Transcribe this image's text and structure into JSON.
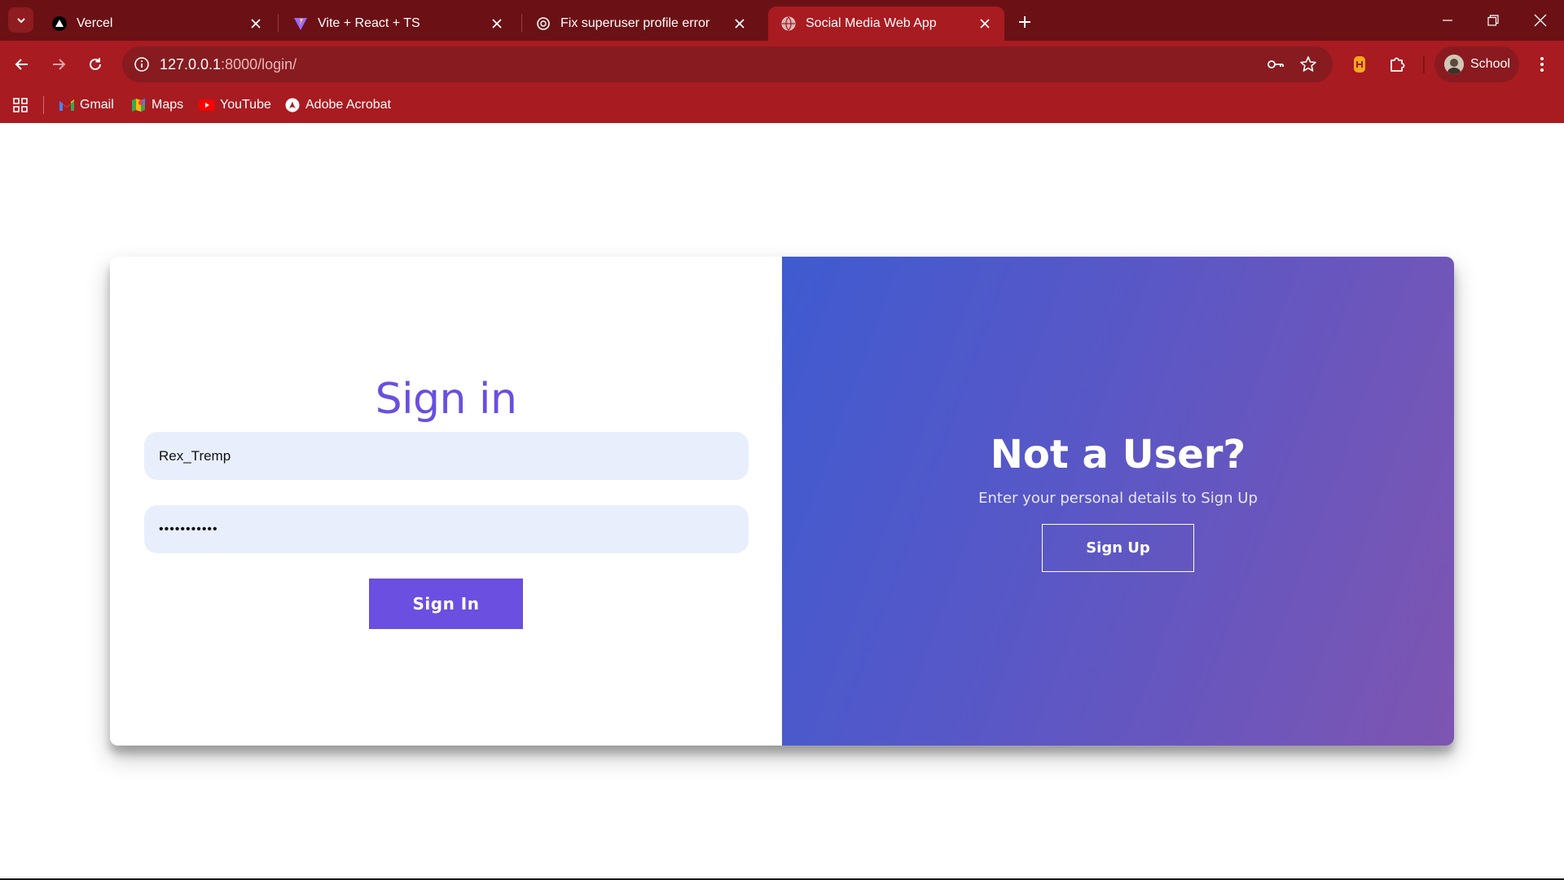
{
  "browser": {
    "tabs": [
      {
        "title": "Vercel",
        "icon": "vercel-icon",
        "active": false
      },
      {
        "title": "Vite + React + TS",
        "icon": "vite-icon",
        "active": false
      },
      {
        "title": "Fix superuser profile error",
        "icon": "chatgpt-icon",
        "active": false
      },
      {
        "title": "Social Media Web App",
        "icon": "globe-icon",
        "active": true
      }
    ],
    "url_host": "127.0.0.1",
    "url_path": ":8000/login/",
    "profile_name": "School",
    "bookmarks": [
      {
        "label": "Gmail",
        "icon": "gmail-icon"
      },
      {
        "label": "Maps",
        "icon": "maps-icon"
      },
      {
        "label": "YouTube",
        "icon": "youtube-icon"
      },
      {
        "label": "Adobe Acrobat",
        "icon": "acrobat-icon"
      }
    ],
    "colors": {
      "tabbar": "#6b1115",
      "toolbar": "#a81b21"
    }
  },
  "page": {
    "signin": {
      "heading": "Sign in",
      "username_value": "Rex_Tremp",
      "password_value": "•••••••••••",
      "button_label": "Sign In"
    },
    "overlay": {
      "heading": "Not a User?",
      "subtext": "Enter your personal details to Sign Up",
      "button_label": "Sign Up"
    },
    "colors": {
      "accent": "#6a4fe0",
      "gradient_start": "#3f5bd0",
      "gradient_end": "#7e55b1",
      "input_bg": "#e8eefc"
    }
  }
}
